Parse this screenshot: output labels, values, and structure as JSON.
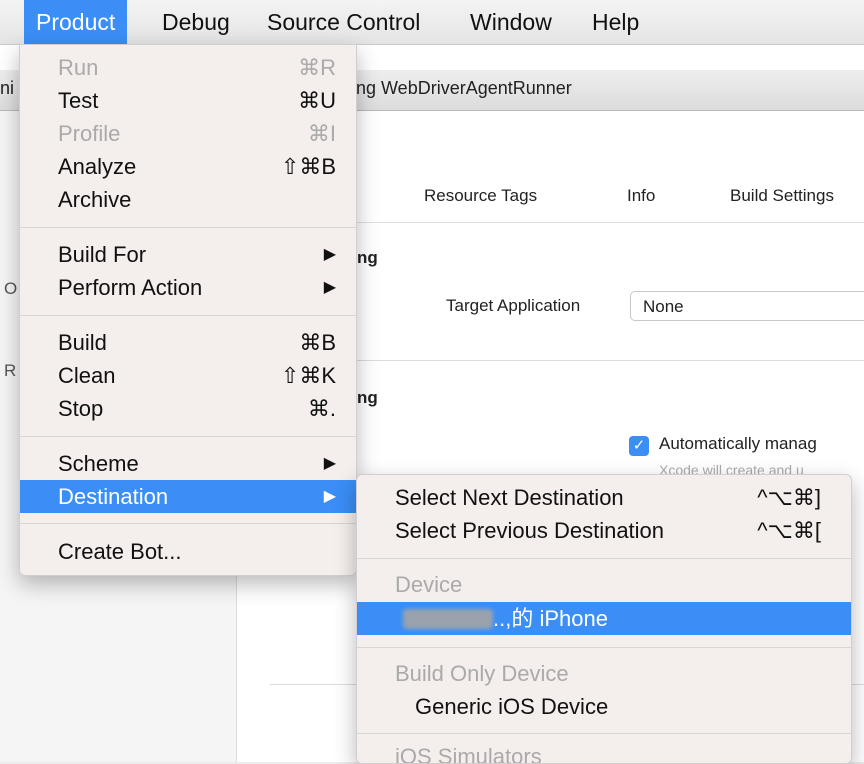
{
  "menubar": {
    "items": [
      "Product",
      "Debug",
      "Source Control",
      "Window",
      "Help"
    ]
  },
  "window": {
    "title": "ng WebDriverAgentRunner",
    "title_left": "ni",
    "sidebar_fragments": [
      "O",
      "R"
    ],
    "tabs": [
      "Resource Tags",
      "Info",
      "Build Settings"
    ],
    "section1": "ng",
    "target_label": "Target Application",
    "target_value": "None",
    "section2": "ng",
    "auto_label": "Automatically manag",
    "auto_sub": "Xcode will create and u"
  },
  "product_menu": {
    "items": [
      {
        "label": "Run",
        "shortcut": "⌘R",
        "disabled": true
      },
      {
        "label": "Test",
        "shortcut": "⌘U"
      },
      {
        "label": "Profile",
        "shortcut": "⌘I",
        "disabled": true
      },
      {
        "label": "Analyze",
        "shortcut": "⇧⌘B"
      },
      {
        "label": "Archive",
        "shortcut": ""
      },
      {
        "label": "Build For",
        "submenu": true
      },
      {
        "label": "Perform Action",
        "submenu": true
      },
      {
        "label": "Build",
        "shortcut": "⌘B"
      },
      {
        "label": "Clean",
        "shortcut": "⇧⌘K"
      },
      {
        "label": "Stop",
        "shortcut": "⌘."
      },
      {
        "label": "Scheme",
        "submenu": true
      },
      {
        "label": "Destination",
        "submenu": true,
        "active": true
      },
      {
        "label": "Create Bot...",
        "shortcut": ""
      }
    ]
  },
  "destination_menu": {
    "next": {
      "label": "Select Next Destination",
      "shortcut": "^⌥⌘]"
    },
    "prev": {
      "label": "Select Previous Destination",
      "shortcut": "^⌥⌘["
    },
    "device_header": "Device",
    "device_name": "..,的 iPhone",
    "build_only_header": "Build Only Device",
    "generic_device": "Generic iOS Device",
    "simulator_header": "iOS Simulators"
  },
  "colors": {
    "accent": "#3a8ef6",
    "disabled": "#aaaaaa"
  }
}
